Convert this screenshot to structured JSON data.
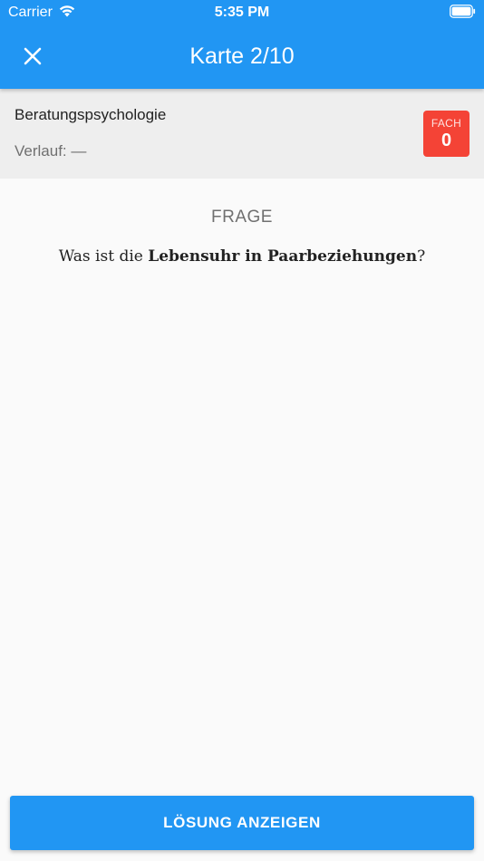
{
  "status_bar": {
    "carrier": "Carrier",
    "time": "5:35 PM",
    "icons": [
      "wifi-icon",
      "battery-icon"
    ]
  },
  "app_bar": {
    "title": "Karte 2/10",
    "close_icon": "close-icon",
    "background_color": "#2196f3"
  },
  "card_info": {
    "subject": "Beratungspsychologie",
    "history_label": "Verlauf:",
    "history_value": "—",
    "box_label": "FACH",
    "box_value": "0",
    "box_color": "#f44336"
  },
  "question": {
    "label": "FRAGE",
    "prefix": "Was ist die",
    "highlight": "Lebensuhr in Paarbeziehungen",
    "suffix": "?"
  },
  "action": {
    "label": "LÖSUNG ANZEIGEN"
  }
}
